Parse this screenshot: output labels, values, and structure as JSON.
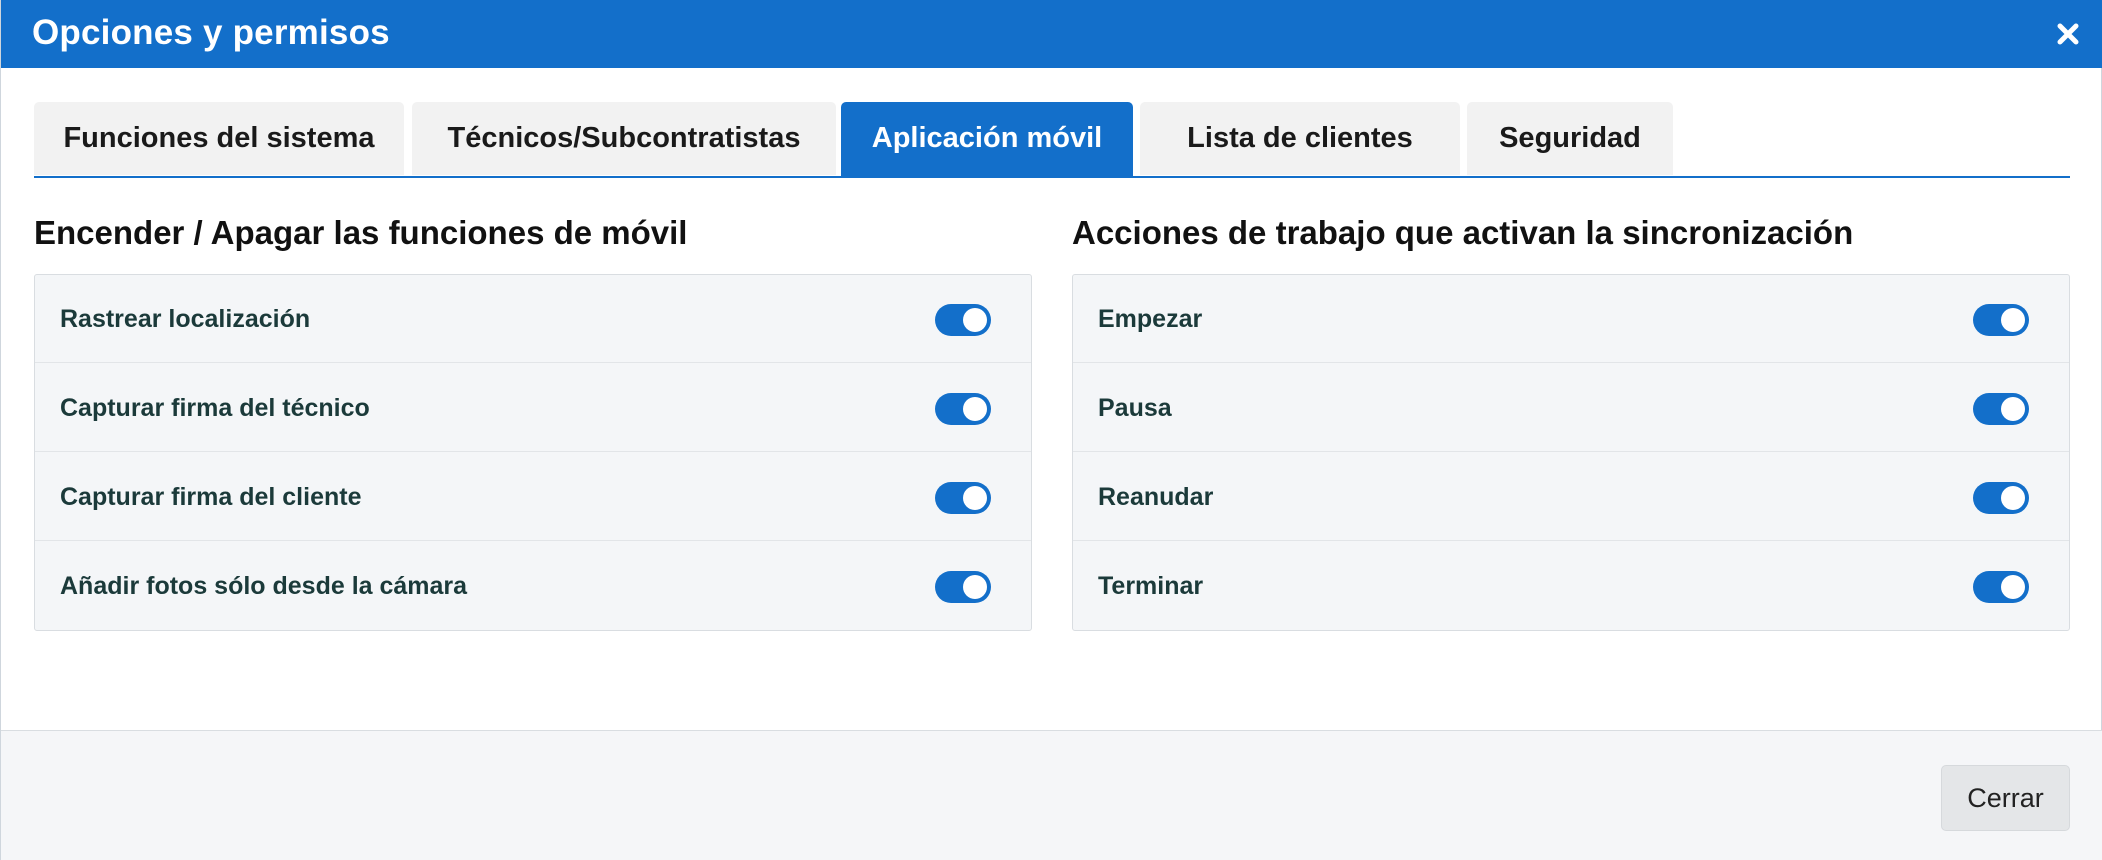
{
  "header": {
    "title": "Opciones y permisos",
    "close_icon": "close-icon"
  },
  "tabs": [
    {
      "label": "Funciones del sistema",
      "active": false
    },
    {
      "label": "Técnicos/Subcontratistas",
      "active": false
    },
    {
      "label": "Aplicación móvil",
      "active": true
    },
    {
      "label": "Lista de clientes",
      "active": false
    },
    {
      "label": "Seguridad",
      "active": false
    }
  ],
  "left_section": {
    "title": "Encender / Apagar las funciones de móvil",
    "items": [
      {
        "label": "Rastrear localización",
        "enabled": true
      },
      {
        "label": "Capturar firma del técnico",
        "enabled": true
      },
      {
        "label": "Capturar firma del cliente",
        "enabled": true
      },
      {
        "label": "Añadir fotos sólo desde la cámara",
        "enabled": true
      }
    ]
  },
  "right_section": {
    "title": "Acciones de trabajo que activan la sincronización",
    "items": [
      {
        "label": "Empezar",
        "enabled": true
      },
      {
        "label": "Pausa",
        "enabled": true
      },
      {
        "label": "Reanudar",
        "enabled": true
      },
      {
        "label": "Terminar",
        "enabled": true
      }
    ]
  },
  "footer": {
    "close_label": "Cerrar"
  },
  "colors": {
    "accent": "#136fca",
    "tab_inactive": "#f2f2f2",
    "panel_bg": "#f4f6f8",
    "label_text": "#1b3a3a"
  }
}
